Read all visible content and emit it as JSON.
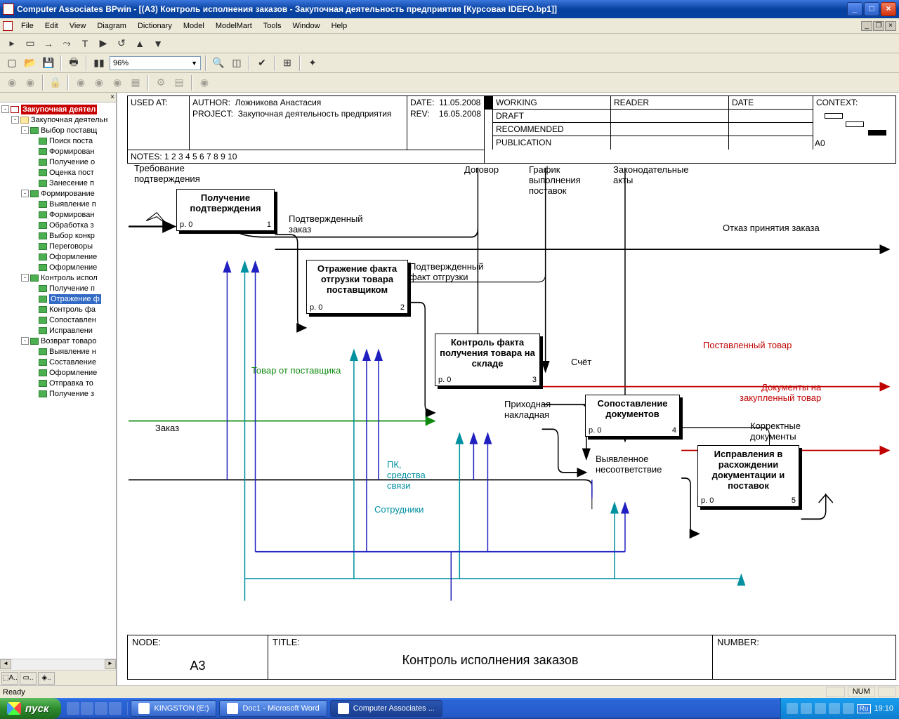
{
  "window": {
    "title": "Computer Associates BPwin - [(A3) Контроль  исполнения  заказов - Закупочная деятельность предприятия  [Курсовая IDEFO.bp1]]"
  },
  "menu": {
    "file": "File",
    "edit": "Edit",
    "view": "View",
    "diagram": "Diagram",
    "dictionary": "Dictionary",
    "model": "Model",
    "modelmart": "ModelMart",
    "tools": "Tools",
    "window": "Window",
    "help": "Help"
  },
  "toolbar": {
    "zoom": "96%"
  },
  "tree": {
    "root": "Закупочная деятел",
    "items": [
      {
        "lvl": 1,
        "toggle": "-",
        "icon": "folder",
        "label": "Закупочная деятельн"
      },
      {
        "lvl": 2,
        "toggle": "-",
        "icon": "green",
        "label": "Выбор поставщ"
      },
      {
        "lvl": 3,
        "icon": "green",
        "label": "Поиск поста"
      },
      {
        "lvl": 3,
        "icon": "green",
        "label": "Формирован"
      },
      {
        "lvl": 3,
        "icon": "green",
        "label": "Получение о"
      },
      {
        "lvl": 3,
        "icon": "green",
        "label": "Оценка пост"
      },
      {
        "lvl": 3,
        "icon": "green",
        "label": "Занесение п"
      },
      {
        "lvl": 2,
        "toggle": "-",
        "icon": "green",
        "label": "Формирование"
      },
      {
        "lvl": 3,
        "icon": "green",
        "label": "Выявление п"
      },
      {
        "lvl": 3,
        "icon": "green",
        "label": "Формирован"
      },
      {
        "lvl": 3,
        "icon": "green",
        "label": "Обработка з"
      },
      {
        "lvl": 3,
        "icon": "green",
        "label": "Выбор конкр"
      },
      {
        "lvl": 3,
        "icon": "green",
        "label": "Переговоры"
      },
      {
        "lvl": 3,
        "icon": "green",
        "label": "Оформление"
      },
      {
        "lvl": 3,
        "icon": "green",
        "label": "Оформление"
      },
      {
        "lvl": 2,
        "toggle": "-",
        "icon": "green",
        "label": "Контроль испол"
      },
      {
        "lvl": 3,
        "icon": "green",
        "label": "Получение п"
      },
      {
        "lvl": 3,
        "icon": "green",
        "label": "Отражение ф",
        "selected": true
      },
      {
        "lvl": 3,
        "icon": "green",
        "label": "Контроль фа"
      },
      {
        "lvl": 3,
        "icon": "green",
        "label": "Сопоставлен"
      },
      {
        "lvl": 3,
        "icon": "green",
        "label": "Исправлени"
      },
      {
        "lvl": 2,
        "toggle": "-",
        "icon": "green",
        "label": "Возврат товаро"
      },
      {
        "lvl": 3,
        "icon": "green",
        "label": "Выявление н"
      },
      {
        "lvl": 3,
        "icon": "green",
        "label": "Составление"
      },
      {
        "lvl": 3,
        "icon": "green",
        "label": "Оформление"
      },
      {
        "lvl": 3,
        "icon": "green",
        "label": "Отправка то"
      },
      {
        "lvl": 3,
        "icon": "green",
        "label": "Получение з"
      }
    ]
  },
  "header": {
    "used_at": "USED AT:",
    "author_lbl": "AUTHOR:",
    "author": "Ложникова Анастасия",
    "project_lbl": "PROJECT:",
    "project": "Закупочная деятельность предприятия",
    "notes": "NOTES:  1  2  3  4  5  6  7  8  9  10",
    "date_lbl": "DATE:",
    "date": "11.05.2008",
    "rev_lbl": "REV:",
    "rev": "16.05.2008",
    "statuses": [
      "WORKING",
      "DRAFT",
      "RECOMMENDED",
      "PUBLICATION"
    ],
    "reader": "READER",
    "reader_date": "DATE",
    "context": "CONTEXT:",
    "context_id": "A0"
  },
  "activities": {
    "a1": {
      "title": "Получение подтверждения",
      "p": "p. 0",
      "n": "1"
    },
    "a2": {
      "title": "Отражение факта отгрузки товара поставщиком",
      "p": "p. 0",
      "n": "2"
    },
    "a3": {
      "title": "Контроль факта получения товара на складе",
      "p": "p. 0",
      "n": "3"
    },
    "a4": {
      "title": "Сопоставление документов",
      "p": "p. 0",
      "n": "4"
    },
    "a5": {
      "title": "Исправления в расхождении документации и поставок",
      "p": "p. 0",
      "n": "5"
    }
  },
  "labels": {
    "tr": "Требование\nподтверждения",
    "dogovor": "Договор",
    "grafik": "График\nвыполнения\nпоставок",
    "zakon": "Законодательные\nакты",
    "podtv_zakaz": "Подтвержденный\nзаказ",
    "otkaz": "Отказ принятия заказа",
    "podtv_fakt": "Подтвержденный\nфакт отгрузки",
    "tovar_ot": "Товар от поставщика",
    "zakaz": "Заказ",
    "schet": "Счёт",
    "prih": "Приходная\nнакладная",
    "post_tovar": "Поставленный  товар",
    "dok_na": "Документы на\nзакупленный товар",
    "korr": "Корректные\nдокументы",
    "vyyav": "Выявленное\nнесоответствие",
    "pk": "ПК,\nсредства\nсвязи",
    "sotr": "Сотрудники"
  },
  "footer": {
    "node": "NODE:",
    "node_id": "A3",
    "title_lbl": "TITLE:",
    "title": "Контроль  исполнения  заказов",
    "number": "NUMBER:"
  },
  "status": {
    "ready": "Ready",
    "num": "NUM"
  },
  "taskbar": {
    "start": "пуск",
    "tasks": [
      "KINGSTON (E:)",
      "Doc1 - Microsoft Word",
      "Computer Associates ..."
    ],
    "lang": "Ru",
    "time": "19:10"
  }
}
